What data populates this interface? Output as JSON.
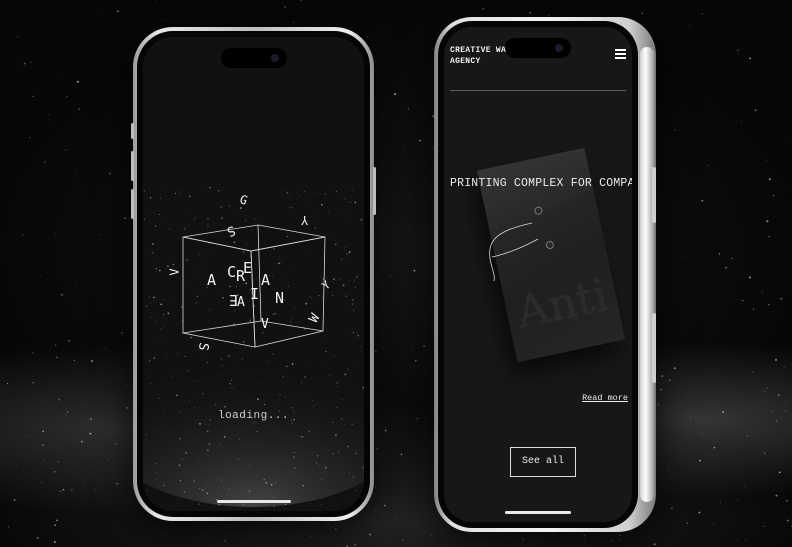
{
  "loader_screen": {
    "status_text": "loading...",
    "letters": [
      "G",
      "S",
      "Y",
      "V",
      "A",
      "C",
      "R",
      "E",
      "A",
      "I",
      "N",
      "E",
      "A",
      "V",
      "S",
      "W",
      "Y"
    ]
  },
  "agency_screen": {
    "brand_line1": "CREATIVE WAVES",
    "brand_line2": "AGENCY",
    "menu_icon": "hamburger-menu-icon",
    "hero_title": "PRINTING COMPLEX FOR COMPANY",
    "mockup_logo_text": "Anti",
    "read_more_label": "Read more",
    "see_all_label": "See all"
  },
  "colors": {
    "background": "#0b0b0b",
    "text": "#eaeaea",
    "screen": "#171717"
  }
}
